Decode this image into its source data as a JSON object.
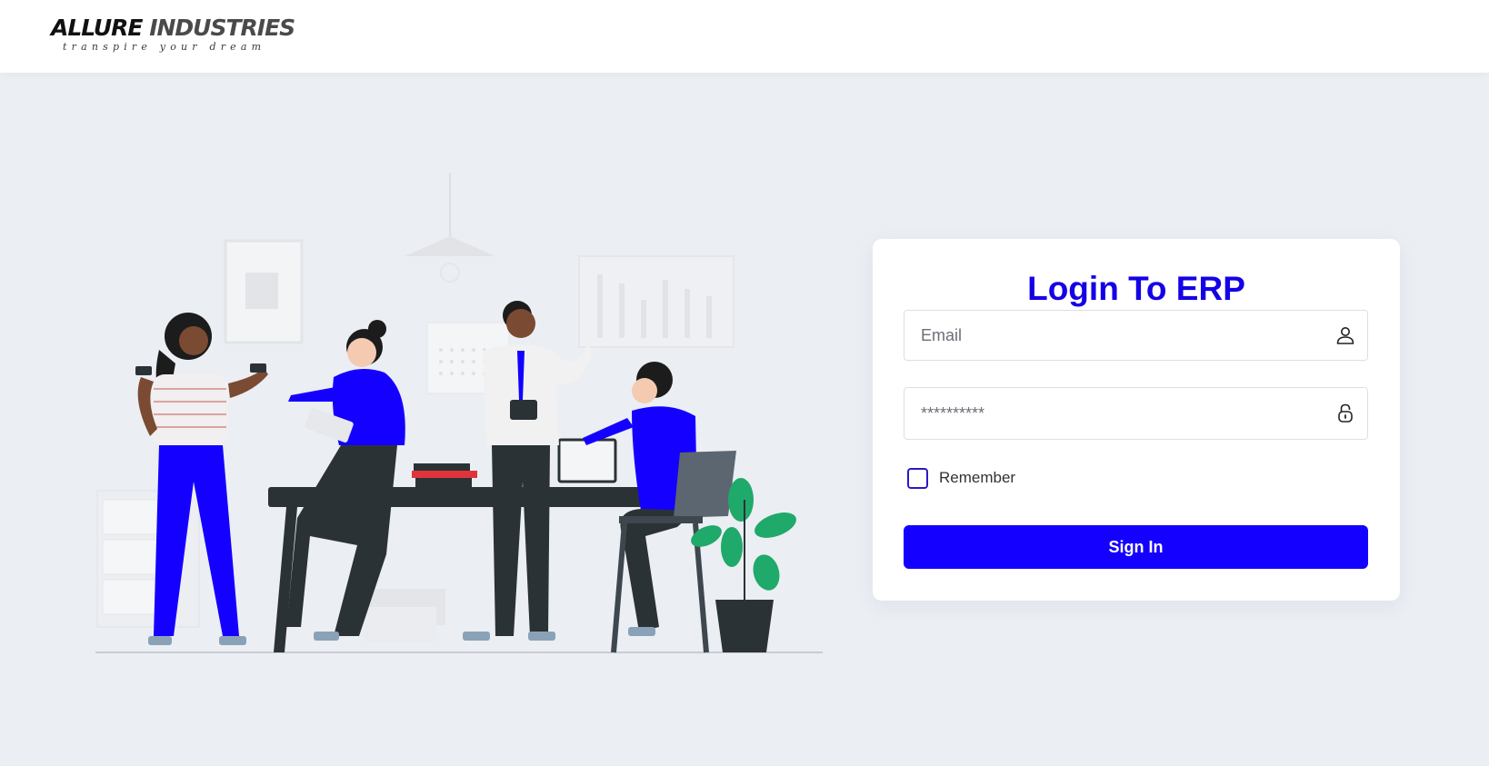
{
  "header": {
    "logo": {
      "brand_part1": "ALLURE",
      "brand_part2": "INDUSTRIES",
      "tagline": "transpire your dream"
    }
  },
  "illustration": {
    "name": "team-meeting-illustration",
    "colors": {
      "accent": "#1400ff",
      "dark": "#2b3236",
      "plant": "#1fa96a"
    }
  },
  "login": {
    "title": "Login To ERP",
    "email": {
      "placeholder": "Email",
      "value": "",
      "icon": "user-icon"
    },
    "password": {
      "placeholder": "**********",
      "value": "",
      "icon": "lock-icon"
    },
    "remember_label": "Remember",
    "remember_checked": false,
    "submit_label": "Sign In"
  },
  "colors": {
    "primary": "#1400ff",
    "title": "#1400e6",
    "page_bg": "#ebeef3",
    "card_bg": "#ffffff"
  }
}
